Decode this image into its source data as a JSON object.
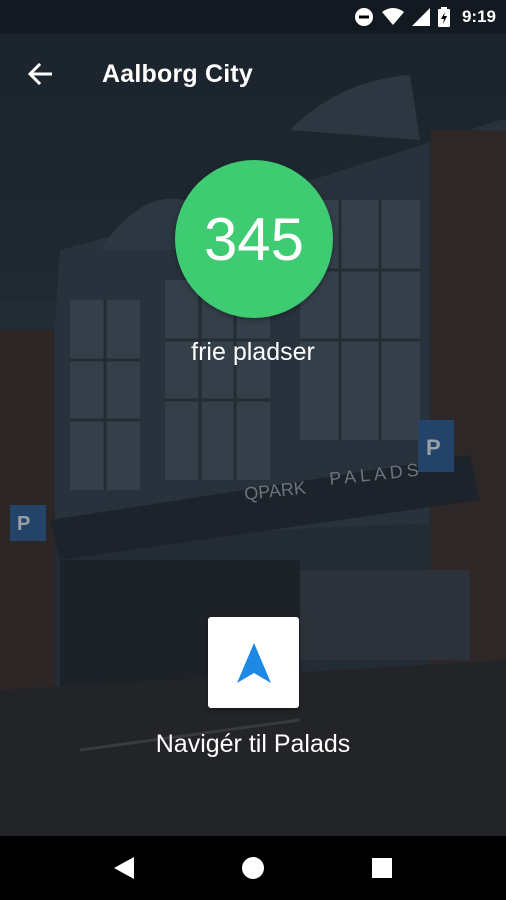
{
  "status_bar": {
    "time": "9:19",
    "icons": [
      "do-not-disturb-icon",
      "wifi-icon",
      "signal-icon",
      "battery-charging-icon"
    ]
  },
  "app_bar": {
    "title": "Aalborg City",
    "back_icon": "arrow-back-icon"
  },
  "parking": {
    "free_count": "345",
    "free_label": "frie pladser",
    "badge_color": "#3ecb72"
  },
  "navigate": {
    "label": "Navigér til Palads",
    "icon": "navigation-arrow-icon",
    "icon_color": "#1e88e5"
  },
  "background_signage": {
    "brand": "QPARK",
    "building": "PALADS",
    "parking_sign": "P"
  },
  "system_nav": {
    "icons": [
      "back-triangle-icon",
      "home-circle-icon",
      "recents-square-icon"
    ]
  }
}
